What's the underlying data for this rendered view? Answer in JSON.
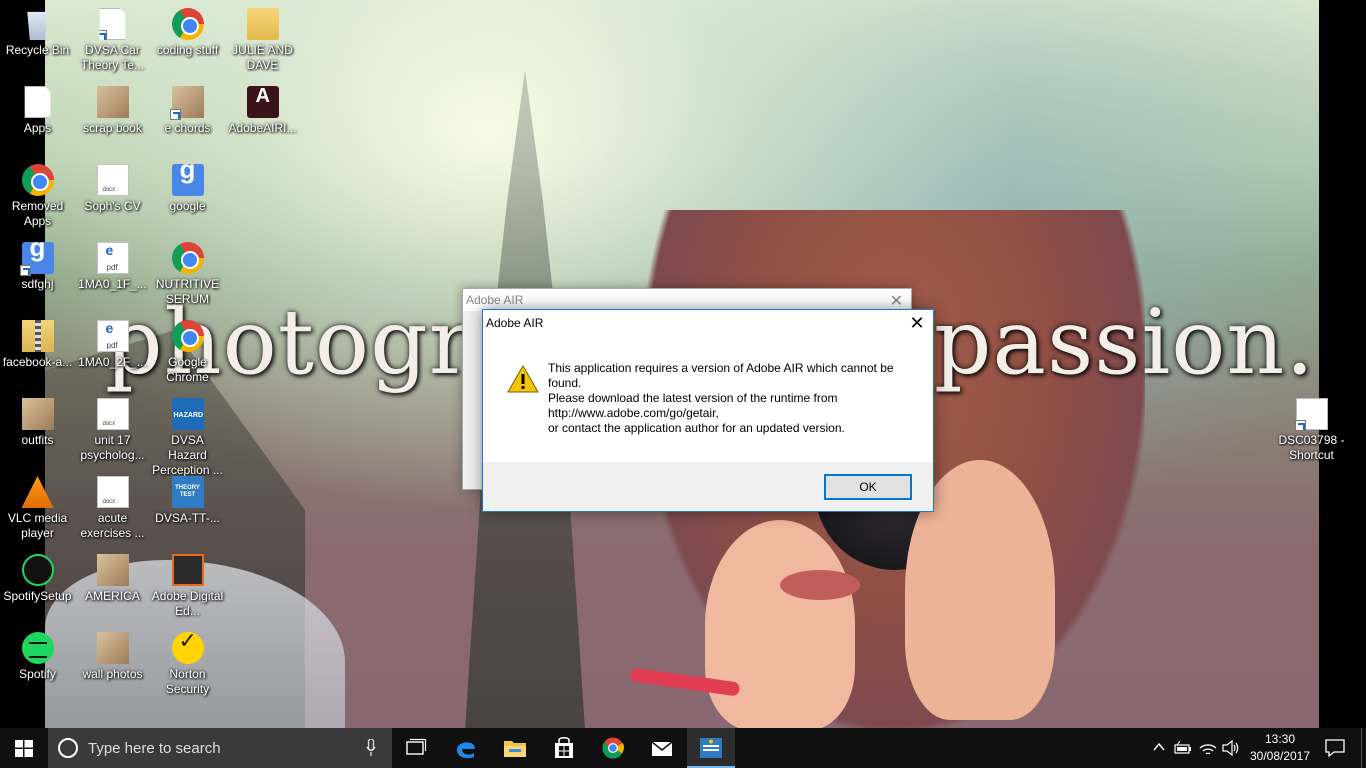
{
  "wallpaper": {
    "text_left": "photogra",
    "text_right": "passion."
  },
  "desktop_icons": [
    {
      "label": "Recycle Bin",
      "icon": "recycle-bin-icon"
    },
    {
      "label": "DVSA Car Theory Te...",
      "icon": "document-shortcut-icon"
    },
    {
      "label": "coding stuff",
      "icon": "chrome-icon"
    },
    {
      "label": "JULIE AND DAVE",
      "icon": "folder-icon"
    },
    {
      "label": "Apps",
      "icon": "file-icon"
    },
    {
      "label": "scrap book",
      "icon": "photo-folder-icon"
    },
    {
      "label": "e chords",
      "icon": "photo-folder-icon"
    },
    {
      "label": "AdobeAIRI...",
      "icon": "adobe-air-installer-icon"
    },
    {
      "label": "Removed Apps",
      "icon": "chrome-icon"
    },
    {
      "label": "Soph's CV",
      "icon": "docx-icon"
    },
    {
      "label": "google",
      "icon": "google-icon"
    },
    {
      "label": "sdfghj",
      "icon": "google-icon"
    },
    {
      "label": "1MA0_1F_...",
      "icon": "pdf-icon"
    },
    {
      "label": "NUTRITIVE SERUM",
      "icon": "chrome-icon"
    },
    {
      "label": "facebook-a...",
      "icon": "zip-folder-icon"
    },
    {
      "label": "1MA0_2F_...",
      "icon": "pdf-icon"
    },
    {
      "label": "Google Chrome",
      "icon": "chrome-icon"
    },
    {
      "label": "outfits",
      "icon": "photo-folder-icon"
    },
    {
      "label": "unit 17 psycholog...",
      "icon": "docx-icon"
    },
    {
      "label": "DVSA Hazard Perception ...",
      "icon": "hazard-perception-icon"
    },
    {
      "label": "VLC media player",
      "icon": "vlc-icon"
    },
    {
      "label": "acute exercises ...",
      "icon": "docx-icon"
    },
    {
      "label": "DVSA-TT-...",
      "icon": "theory-test-icon"
    },
    {
      "label": "SpotifySetup",
      "icon": "spotify-setup-icon"
    },
    {
      "label": "AMERICA",
      "icon": "photo-folder-icon"
    },
    {
      "label": "Adobe Digital Ed...",
      "icon": "adobe-digital-editions-icon"
    },
    {
      "label": "Spotify",
      "icon": "spotify-icon"
    },
    {
      "label": "wall photos",
      "icon": "photo-folder-icon"
    },
    {
      "label": "Norton Security",
      "icon": "norton-icon"
    },
    {
      "label": "DSC03798 - Shortcut",
      "icon": "file-shortcut-icon"
    }
  ],
  "dialog_back": {
    "title": "Adobe AIR",
    "close": "✕"
  },
  "dialog": {
    "title": "Adobe AIR",
    "close": "✕",
    "message_line1": "This application requires a version of Adobe AIR which cannot be found.",
    "message_line2": "Please download the latest version of the runtime from",
    "message_line3": "http://www.adobe.com/go/getair,",
    "message_line4": "or contact the application author for an updated version.",
    "ok_label": "OK",
    "icon": "warning-icon"
  },
  "taskbar": {
    "search_placeholder": "Type here to search",
    "apps": [
      {
        "name": "task-view",
        "icon": "task-view-icon"
      },
      {
        "name": "edge",
        "icon": "edge-icon"
      },
      {
        "name": "file-explorer",
        "icon": "folder-icon"
      },
      {
        "name": "store",
        "icon": "store-icon"
      },
      {
        "name": "chrome",
        "icon": "chrome-icon"
      },
      {
        "name": "mail",
        "icon": "mail-icon"
      },
      {
        "name": "theory-test",
        "icon": "theory-test-icon"
      }
    ],
    "time": "13:30",
    "date": "30/08/2017"
  },
  "colors": {
    "accent": "#0078d7",
    "taskbar": "#101010",
    "warning": "#f7c600"
  }
}
